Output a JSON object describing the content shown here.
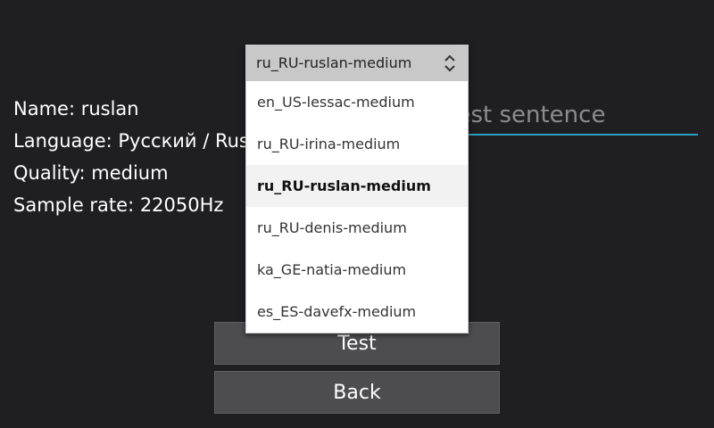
{
  "info": {
    "name": "Name: ruslan",
    "language": "Language: Русский / Russian",
    "quality": "Quality: medium",
    "sample_rate": "Sample rate: 22050Hz"
  },
  "text_input": {
    "placeholder": "Test sentence"
  },
  "voice_select": {
    "selected": "ru_RU-ruslan-medium",
    "options": [
      "en_US-lessac-medium",
      "ru_RU-irina-medium",
      "ru_RU-ruslan-medium",
      "ru_RU-denis-medium",
      "ka_GE-natia-medium",
      "es_ES-davefx-medium"
    ]
  },
  "buttons": {
    "test": "Test",
    "back": "Back"
  },
  "icons": {
    "select_chevrons": "chevron-up-down-icon"
  },
  "colors": {
    "background": "#1f1e21",
    "accent_underline": "#2a9fbf",
    "button_bg": "#4d4c4f"
  }
}
